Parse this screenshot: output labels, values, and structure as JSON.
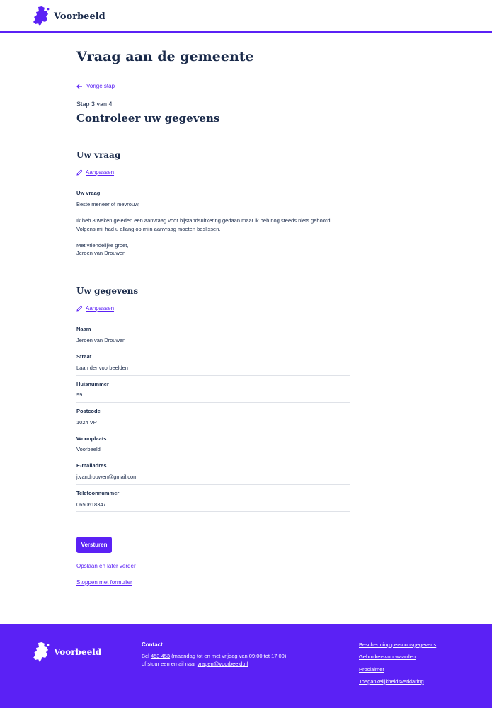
{
  "header": {
    "brand": "Voorbeeld"
  },
  "page": {
    "title": "Vraag aan de gemeente",
    "back_label": "Vorige stap",
    "step": "Stap 3 van 4",
    "step_title": "Controleer uw gegevens"
  },
  "question": {
    "title": "Uw vraag",
    "edit_label": "Aanpassen",
    "field_label": "Uw vraag",
    "lines": [
      "Beste meneer of mevrouw,",
      "Ik heb 8 weken geleden een aanvraag voor bijstandsuitkering gedaan maar ik heb nog steeds niets gehoord.",
      "Volgens mij had u allang op mijn aanvraag moeten beslissen.",
      "Met vriendelijke groet,",
      "Jeroen van Drouwen"
    ]
  },
  "details": {
    "title": "Uw gegevens",
    "edit_label": "Aanpassen",
    "fields": [
      {
        "label": "Naam",
        "value": "Jeroen van Drouwen"
      },
      {
        "label": "Straat",
        "value": "Laan der voorbeelden"
      },
      {
        "label": "Huisnummer",
        "value": "99"
      },
      {
        "label": "Postcode",
        "value": "1024 VP"
      },
      {
        "label": "Woonplaats",
        "value": "Voorbeeld"
      },
      {
        "label": "E-mailadres",
        "value": "j.vandrouwen@gmail.com"
      },
      {
        "label": "Telefoonnummer",
        "value": "0650618347"
      }
    ]
  },
  "actions": {
    "submit": "Versturen",
    "save_later": "Opslaan en later verder",
    "stop": "Stoppen met formulier"
  },
  "footer": {
    "brand": "Voorbeeld",
    "contact_title": "Contact",
    "phone_prefix": "Bel ",
    "phone": "453 453",
    "phone_suffix": " (maandag tot en met vrijdag van 09:00 tot 17:00)",
    "email_prefix": "of stuur een email naar ",
    "email": "vragen@voorbeeld.nl",
    "links": [
      "Bescherming persoonsgegevens",
      "Gebruikersvoorwaarden",
      "Proclaimer",
      "Toegankelijkheidsverklaring"
    ]
  },
  "colors": {
    "accent": "#5b21f5",
    "text": "#1a2a4a",
    "divider": "#dfe2e8"
  }
}
